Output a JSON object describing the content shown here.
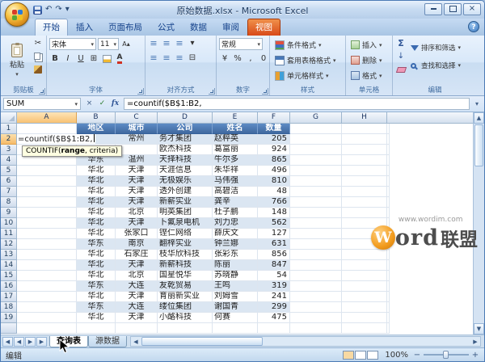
{
  "window": {
    "title": "原始数据.xlsx - Microsoft Excel"
  },
  "icons": {
    "dropdown": "▾",
    "cut": "✂",
    "undo": "↶",
    "redo": "↷",
    "close": "×",
    "help": "?",
    "cancel": "×",
    "enter": "✓",
    "fx": "fx",
    "sigma": "Σ",
    "bold": "B",
    "italic": "I",
    "underline": "U",
    "borders": "⊞",
    "merge": "⊟",
    "lines": "≡",
    "currency": "¥",
    "percent": "%",
    "comma": ",",
    "zero": "0",
    "prev": "◀",
    "next": "▶",
    "up": "▲",
    "down": "▼",
    "minus": "−",
    "plus": "+",
    "arrow_down": "↓",
    "grow_font": "A▴",
    "shrink_font": "A▾",
    "expand": "⌄"
  },
  "ribbon": {
    "tabs": [
      {
        "label": "开始",
        "active": true
      },
      {
        "label": "插入"
      },
      {
        "label": "页面布局"
      },
      {
        "label": "公式"
      },
      {
        "label": "数据"
      },
      {
        "label": "审阅"
      },
      {
        "label": "视图"
      }
    ],
    "groups": {
      "clipboard": {
        "label": "剪贴板",
        "paste_label": "粘贴"
      },
      "font": {
        "label": "字体",
        "font_name": "宋体",
        "font_size": "11"
      },
      "alignment": {
        "label": "对齐方式"
      },
      "number": {
        "label": "数字",
        "format": "常规"
      },
      "styles": {
        "label": "样式",
        "items": [
          "条件格式",
          "套用表格格式",
          "单元格样式"
        ]
      },
      "cells": {
        "label": "单元格",
        "items": [
          "插入",
          "删除",
          "格式"
        ]
      },
      "editing": {
        "label": "编辑",
        "items": [
          "排序和筛选",
          "查找和选择"
        ]
      }
    }
  },
  "formula_bar": {
    "name_box": "SUM",
    "formula": "=countif($B$1:B2,"
  },
  "grid": {
    "column_headers": [
      "A",
      "B",
      "C",
      "D",
      "E",
      "F",
      "G",
      "H"
    ],
    "selected_column": "A",
    "selected_row": "2",
    "header_row": {
      "n": "1",
      "cells": [
        "地区",
        "城市",
        "公司",
        "姓名",
        "数量"
      ]
    },
    "data_rows": [
      [
        "2",
        "",
        "常州",
        "务才集团",
        "赵粹英",
        "205"
      ],
      [
        "3",
        "",
        "",
        "欧杰科技",
        "葛富丽",
        "924"
      ],
      [
        "4",
        "华东",
        "温州",
        "天择科技",
        "牛尔多",
        "865"
      ],
      [
        "5",
        "华北",
        "天津",
        "天涯信息",
        "朱华祥",
        "496"
      ],
      [
        "6",
        "华北",
        "天津",
        "无极娱乐",
        "马伟强",
        "810"
      ],
      [
        "7",
        "华北",
        "天津",
        "透外创建",
        "高碧洁",
        "48"
      ],
      [
        "8",
        "华北",
        "天津",
        "新薪实业",
        "龚辛",
        "766"
      ],
      [
        "9",
        "华北",
        "北京",
        "明英集团",
        "杜子鹏",
        "148"
      ],
      [
        "10",
        "华北",
        "天津",
        "卜氟泉电机",
        "刘力忠",
        "562"
      ],
      [
        "11",
        "华北",
        "张家口",
        "铿仁网络",
        "薛庆文",
        "127"
      ],
      [
        "12",
        "华东",
        "南京",
        "翻梓实业",
        "钟兰娜",
        "631"
      ],
      [
        "13",
        "华北",
        "石家庄",
        "枝华欣科技",
        "张彩东",
        "856"
      ],
      [
        "14",
        "华北",
        "天津",
        "新薪科技",
        "陈丽",
        "847"
      ],
      [
        "15",
        "华北",
        "北京",
        "国星悦华",
        "苏晓静",
        "54"
      ],
      [
        "16",
        "华东",
        "大连",
        "友乾贸易",
        "王鸣",
        "319"
      ],
      [
        "17",
        "华北",
        "天津",
        "育丽新实业",
        "刘姆雪",
        "241"
      ],
      [
        "18",
        "华东",
        "大连",
        "缕位集团",
        "谢国青",
        "299"
      ],
      [
        "19",
        "华北",
        "天津",
        "小酪科技",
        "何赛",
        "475"
      ]
    ],
    "edit_cell_text": "=countif($B$1:B2,",
    "tooltip": {
      "fn": "COUNTIF(",
      "arg": "range",
      "rest": ", criteria)"
    }
  },
  "sheet_bar": {
    "tabs": [
      {
        "label": "查询表",
        "active": true
      },
      {
        "label": "源数据",
        "active": false
      }
    ]
  },
  "status_bar": {
    "mode": "编辑",
    "zoom": "100%"
  },
  "watermark": {
    "url": "www.wordim.com",
    "w": "W",
    "ord": "ord",
    "cn": "联盟"
  }
}
